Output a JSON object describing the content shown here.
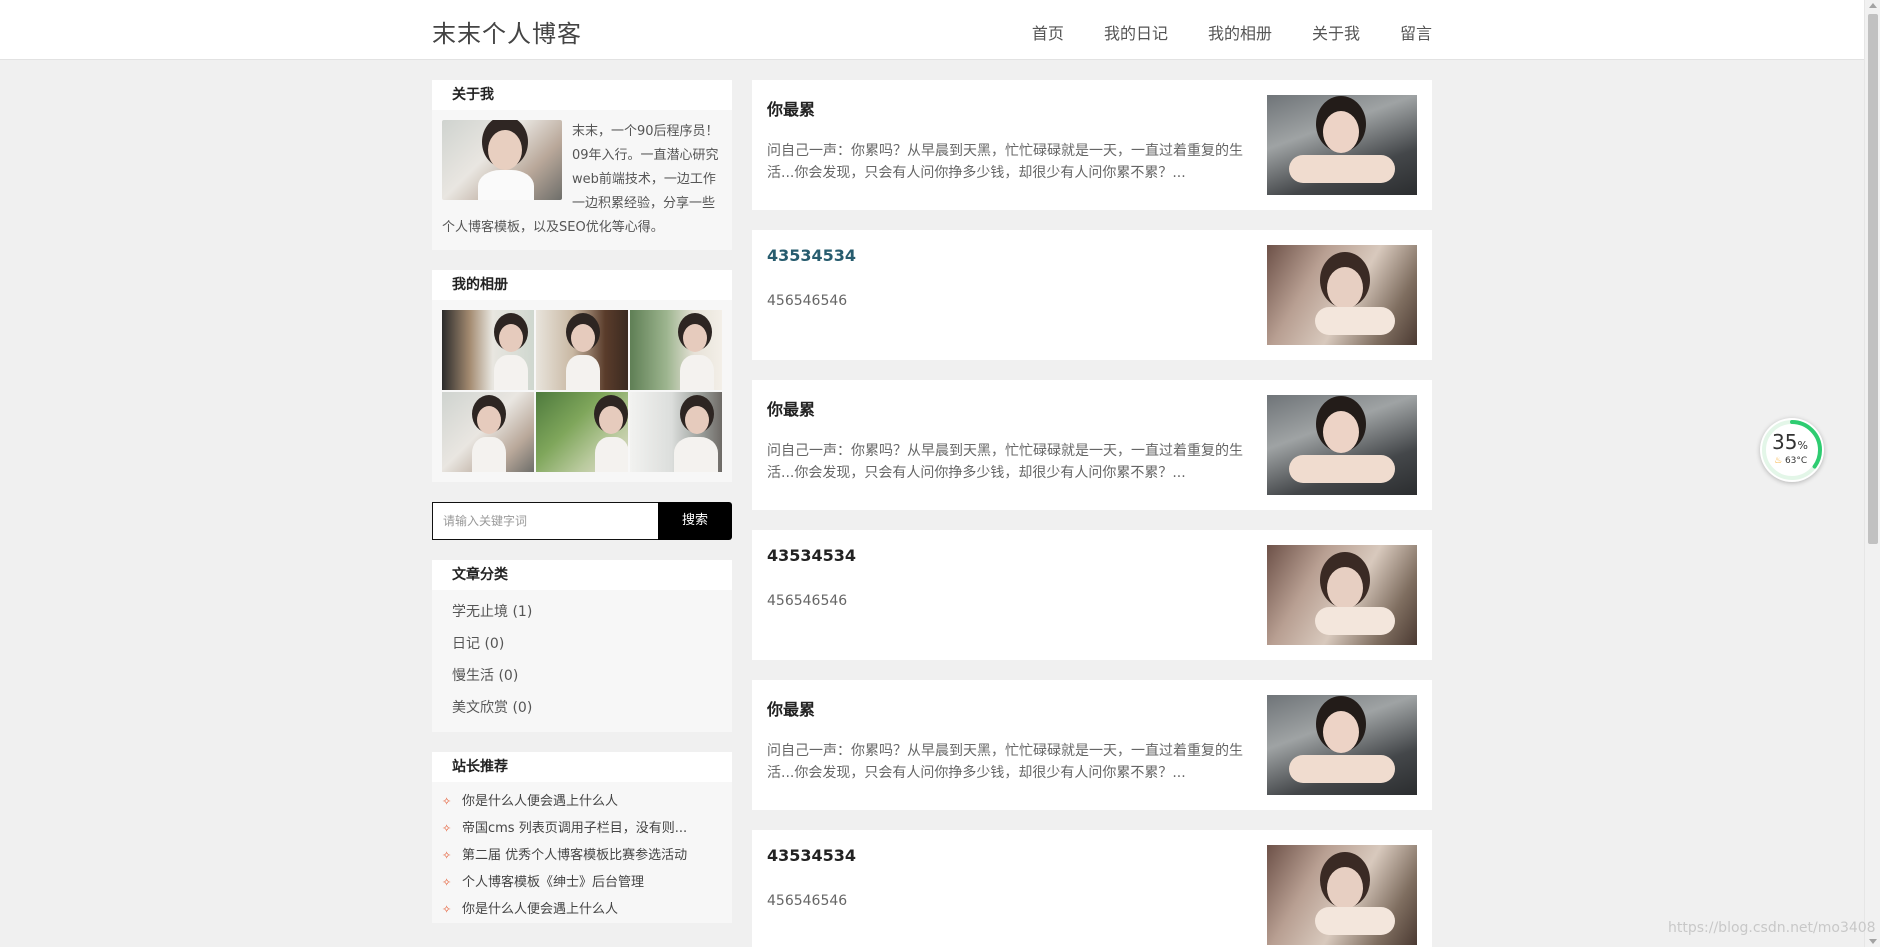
{
  "header": {
    "site_title": "末末个人博客",
    "nav": [
      "首页",
      "我的日记",
      "我的相册",
      "关于我",
      "留言"
    ]
  },
  "sidebar": {
    "about": {
      "heading": "关于我",
      "text": "末末，一个90后程序员！09年入行。一直潜心研究web前端技术，一边工作一边积累经验，分享一些个人博客模板，以及SEO优化等心得。"
    },
    "album": {
      "heading": "我的相册"
    },
    "search": {
      "placeholder": "请输入关键字词",
      "button": "搜索"
    },
    "categories": {
      "heading": "文章分类",
      "items": [
        "学无止境 (1)",
        "日记 (0)",
        "慢生活 (0)",
        "美文欣赏 (0)"
      ]
    },
    "recommend": {
      "heading": "站长推荐",
      "items": [
        "你是什么人便会遇上什么人",
        "帝国cms 列表页调用子栏目，没有则...",
        "第二届 优秀个人博客模板比赛参选活动",
        "个人博客模板《绅士》后台管理",
        "你是什么人便会遇上什么人"
      ]
    }
  },
  "articles": [
    {
      "title": "你最累",
      "summary": "问自己一声：你累吗？从早晨到天黑，忙忙碌碌就是一天，一直过着重复的生活...你会发现，只会有人问你挣多少钱，却很少有人问你累不累？..."
    },
    {
      "title": "43534534",
      "summary": "456546546"
    },
    {
      "title": "你最累",
      "summary": "问自己一声：你累吗？从早晨到天黑，忙忙碌碌就是一天，一直过着重复的生活...你会发现，只会有人问你挣多少钱，却很少有人问你累不累？..."
    },
    {
      "title": "43534534",
      "summary": "456546546"
    },
    {
      "title": "你最累",
      "summary": "问自己一声：你累吗？从早晨到天黑，忙忙碌碌就是一天，一直过着重复的生活...你会发现，只会有人问你挣多少钱，却很少有人问你累不累？..."
    },
    {
      "title": "43534534",
      "summary": "456546546"
    }
  ],
  "widget": {
    "percent": "35",
    "percent_unit": "%",
    "temperature": "63°C",
    "usage_fraction": 0.35,
    "ring_color": "#2ecc71"
  },
  "watermark": "https://blog.csdn.net/mo3408"
}
